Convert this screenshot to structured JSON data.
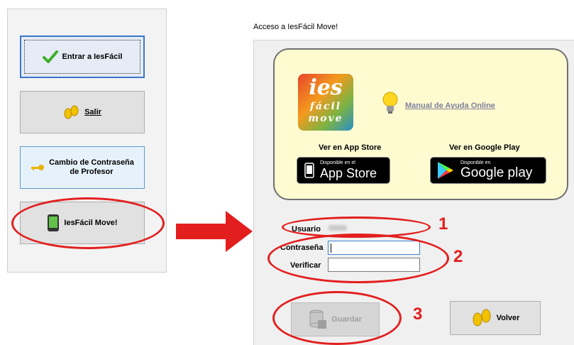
{
  "left_panel": {
    "enter_label": "Entrar a IesFácil",
    "exit_label": "Salir",
    "password_change_label": "Cambio de Contraseña de Profesor",
    "move_label": "IesFácil Move!"
  },
  "dialog": {
    "title": "Acceso a IesFácil Move!",
    "manual_link": "Manual de Ayuda Online",
    "app_store_label": "Ver en App Store",
    "google_play_label": "Ver en Google Play",
    "app_store_badge": {
      "small": "Disponible en el",
      "big": "App Store"
    },
    "google_play_badge": {
      "small": "Disponible en",
      "big": "Google play"
    },
    "logo": {
      "line1": "ies",
      "line2": "fácil",
      "line3": "move"
    },
    "usuario_label": "Usuario",
    "contrasena_label": "Contraseña",
    "verificar_label": "Verificar",
    "contrasena_value": "",
    "verificar_value": "",
    "save_label": "Guardar",
    "back_label": "Volver"
  },
  "annotations": {
    "n1": "1",
    "n2": "2",
    "n3": "3"
  },
  "colors": {
    "highlight": "#e31e1e",
    "card": "#fffbd1",
    "focus": "#3a78c9"
  }
}
